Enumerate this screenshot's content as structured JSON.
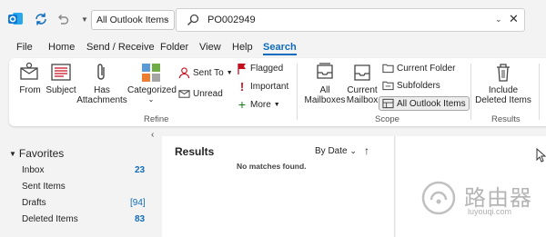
{
  "titlebar": {
    "scope_selected": "All Outlook Items",
    "search_value": "PO002949"
  },
  "menu": {
    "tabs": [
      "File",
      "Home",
      "Send / Receive",
      "Folder",
      "View",
      "Help",
      "Search"
    ],
    "active_tab": "Search"
  },
  "ribbon": {
    "from": "From",
    "subject": "Subject",
    "has_attachments_1": "Has",
    "has_attachments_2": "Attachments",
    "categorized": "Categorized",
    "sent_to": "Sent To",
    "unread": "Unread",
    "flagged": "Flagged",
    "important": "Important",
    "more": "More",
    "refine_label": "Refine",
    "all_mailboxes_1": "All",
    "all_mailboxes_2": "Mailboxes",
    "current_mailbox_1": "Current",
    "current_mailbox_2": "Mailbox",
    "current_folder": "Current Folder",
    "subfolders": "Subfolders",
    "all_outlook_items": "All Outlook Items",
    "scope_label": "Scope",
    "include_deleted_1": "Include",
    "include_deleted_2": "Deleted Items",
    "results_label": "Results"
  },
  "folders": {
    "favorites": "Favorites",
    "inbox": "Inbox",
    "inbox_count": "23",
    "sent": "Sent Items",
    "drafts": "Drafts",
    "drafts_count": "[94]",
    "deleted": "Deleted Items",
    "deleted_count": "83"
  },
  "results": {
    "title": "Results",
    "sort": "By Date",
    "empty": "No matches found."
  },
  "watermark": {
    "main": "路由器",
    "sub": "luyouqi.com"
  },
  "colors": {
    "accent": "#0f6cbd",
    "outlook_blue": "#0f78d4",
    "flag_red": "#c50f1f",
    "plus_green": "#107c10"
  }
}
